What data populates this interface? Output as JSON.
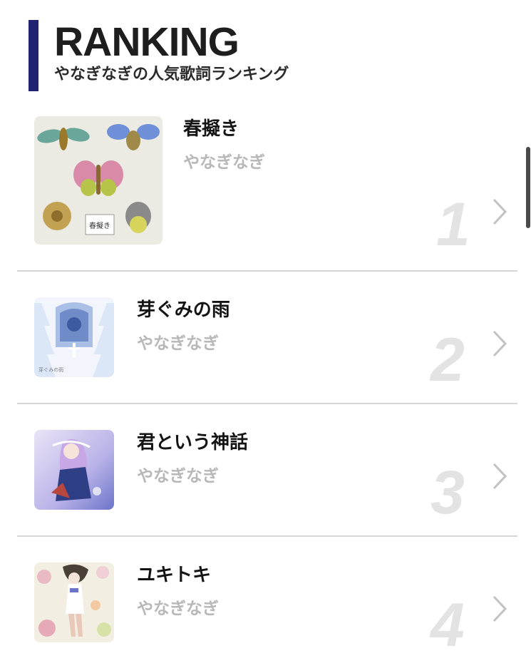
{
  "header": {
    "title": "RANKING",
    "subtitle": "やなぎなぎの人気歌詞ランキング",
    "accent_color": "#1f2370"
  },
  "ranking": [
    {
      "rank": "1",
      "song": "春擬き",
      "artist": "やなぎなぎ",
      "jacket_text": "春擬き",
      "jacket_icon": "insect-jacket-art"
    },
    {
      "rank": "2",
      "song": "芽ぐみの雨",
      "artist": "やなぎなぎ",
      "jacket_text": "芽ぐみの雨",
      "jacket_icon": "paper-cut-forest-jacket-art"
    },
    {
      "rank": "3",
      "song": "君という神話",
      "artist": "やなぎなぎ",
      "jacket_icon": "anime-girl-jacket-art"
    },
    {
      "rank": "4",
      "song": "ユキトキ",
      "artist": "やなぎなぎ",
      "jacket_icon": "flower-girl-jacket-art"
    }
  ]
}
